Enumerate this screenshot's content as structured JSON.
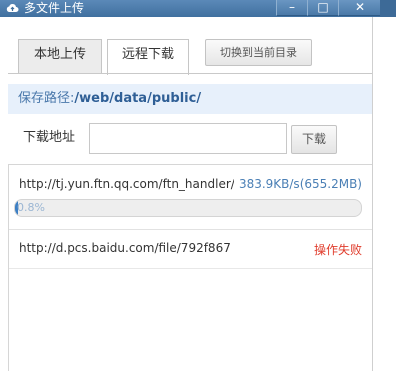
{
  "window": {
    "title": "多文件上传",
    "minimize": "–",
    "maximize": "□",
    "close": "✕"
  },
  "tabs": [
    {
      "label": "本地上传",
      "active": false
    },
    {
      "label": "远程下载",
      "active": true
    }
  ],
  "switch_button": "切换到当前目录",
  "save_path": {
    "label": "保存路径:",
    "value": "/web/data/public/"
  },
  "download": {
    "label": "下载地址",
    "value": "",
    "placeholder": "",
    "button": "下载"
  },
  "downloads": [
    {
      "url": "http://tj.yun.ftn.qq.com/ftn_handler/",
      "speed": "383.9KB/s(655.2MB)",
      "progress_text": "0.8%",
      "progress": 0.008
    },
    {
      "url": "http://d.pcs.baidu.com/file/792f867",
      "status": "操作失败"
    }
  ],
  "colors": {
    "accent": "#3c7fc4",
    "error": "#e03c2c",
    "path": "#2f5f96"
  }
}
